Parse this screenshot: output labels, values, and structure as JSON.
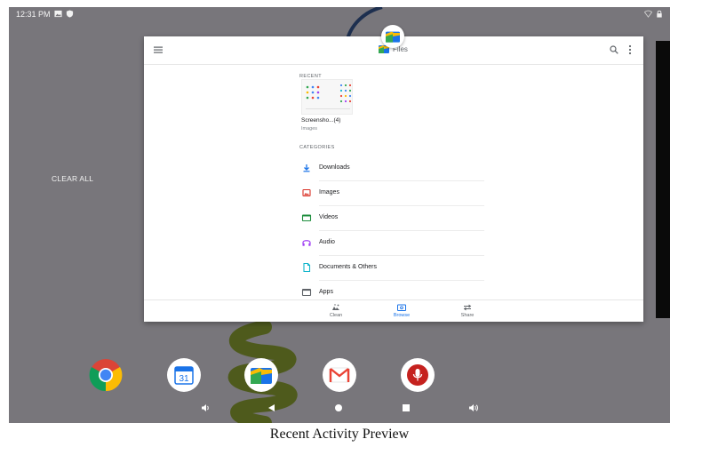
{
  "status_bar": {
    "time": "12:31 PM",
    "icons": [
      "image-icon",
      "shield-icon",
      "wifi-icon",
      "lock-icon"
    ]
  },
  "recents": {
    "clear_all_label": "CLEAR ALL"
  },
  "app_card": {
    "app_name": "Files",
    "toolbar": {
      "title": "Files",
      "icons": [
        "menu-icon",
        "search-icon",
        "more-vert-icon"
      ]
    },
    "recent": {
      "section_label": "RECENT",
      "item_name": "Screensho...(4)",
      "item_subtitle": "Images"
    },
    "categories": {
      "section_label": "CATEGORIES",
      "items": [
        {
          "label": "Downloads",
          "icon": "download-icon",
          "color": "#1a73e8"
        },
        {
          "label": "Images",
          "icon": "image-icon",
          "color": "#d93025"
        },
        {
          "label": "Videos",
          "icon": "video-icon",
          "color": "#1e8e3e"
        },
        {
          "label": "Audio",
          "icon": "audio-icon",
          "color": "#a142f4"
        },
        {
          "label": "Documents & Others",
          "icon": "document-icon",
          "color": "#12b5cb"
        },
        {
          "label": "Apps",
          "icon": "apps-icon",
          "color": "#5f6368"
        }
      ]
    },
    "bottom_nav": {
      "items": [
        {
          "label": "Clean",
          "icon": "clean-icon",
          "active": false
        },
        {
          "label": "Browse",
          "icon": "browse-icon",
          "active": true
        },
        {
          "label": "Share",
          "icon": "share-icon",
          "active": false
        }
      ]
    }
  },
  "dock": {
    "apps": [
      "Chrome",
      "Calendar",
      "Files",
      "Gmail",
      "Voice Recorder"
    ],
    "calendar_day": "31"
  },
  "nav_bar": {
    "buttons": [
      "volume-down-icon",
      "back-icon",
      "home-icon",
      "recents-icon",
      "volume-up-icon"
    ]
  },
  "caption": "Recent Activity Preview",
  "colors": {
    "background": "#78767b",
    "accent": "#1a73e8",
    "wallpaper_stroke": "#4e5a1c"
  }
}
